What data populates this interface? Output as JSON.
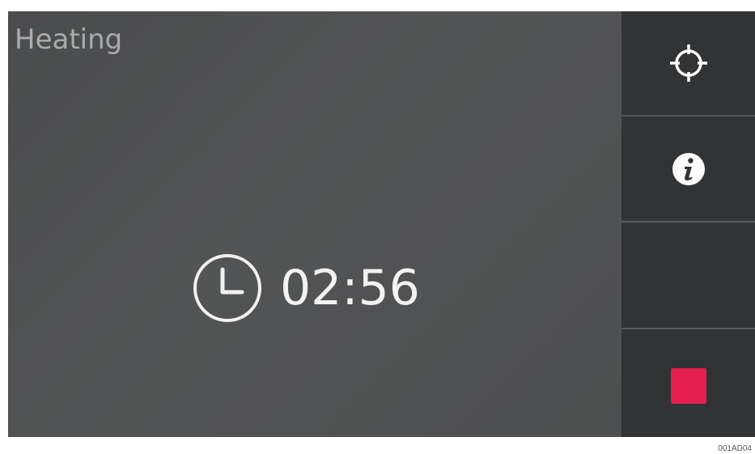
{
  "status": {
    "title": "Heating"
  },
  "timer": {
    "icon": "clock-icon",
    "value": "02:56"
  },
  "side_buttons": [
    {
      "icon": "crosshair-icon"
    },
    {
      "icon": "info-icon"
    },
    {
      "icon": ""
    },
    {
      "icon": "stop-icon",
      "color": "#e31f4d"
    }
  ],
  "figure_code": "001AD04",
  "colors": {
    "panel_bg": "#4f5051",
    "sidebar_bg": "#323334",
    "title_text": "#a9abad",
    "timer_text": "#f2f2f2",
    "stop_accent": "#e31f4d"
  }
}
